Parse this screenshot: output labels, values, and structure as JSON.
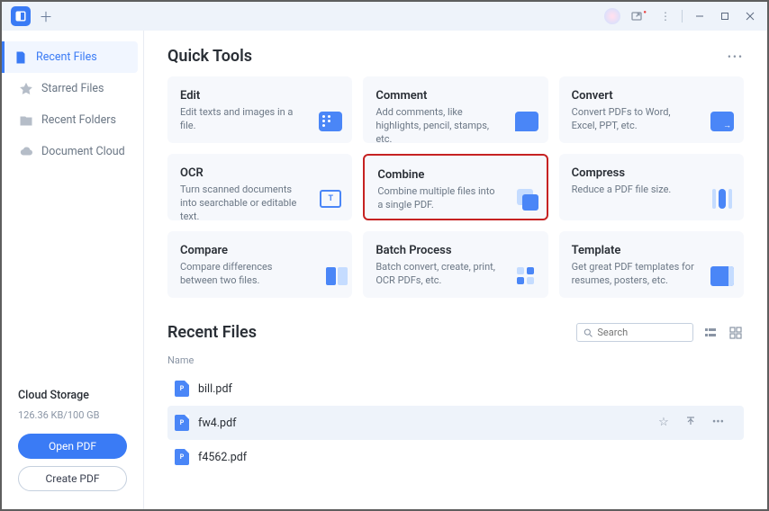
{
  "sidebar": {
    "items": [
      {
        "label": "Recent Files",
        "icon": "file"
      },
      {
        "label": "Starred Files",
        "icon": "star"
      },
      {
        "label": "Recent Folders",
        "icon": "folder"
      },
      {
        "label": "Document Cloud",
        "icon": "cloud"
      }
    ],
    "cloud": {
      "title": "Cloud Storage",
      "usage": "126.36 KB/100 GB",
      "open_label": "Open PDF",
      "create_label": "Create PDF"
    }
  },
  "quick_tools": {
    "title": "Quick Tools",
    "items": [
      {
        "title": "Edit",
        "desc": "Edit texts and images in a file.",
        "icon": "edit"
      },
      {
        "title": "Comment",
        "desc": "Add comments, like highlights, pencil, stamps, etc.",
        "icon": "comment"
      },
      {
        "title": "Convert",
        "desc": "Convert PDFs to Word, Excel, PPT, etc.",
        "icon": "convert"
      },
      {
        "title": "OCR",
        "desc": "Turn scanned documents into searchable or editable text.",
        "icon": "ocr"
      },
      {
        "title": "Combine",
        "desc": "Combine multiple files into a single PDF.",
        "icon": "combine",
        "highlight": true
      },
      {
        "title": "Compress",
        "desc": "Reduce a PDF file size.",
        "icon": "compress"
      },
      {
        "title": "Compare",
        "desc": "Compare differences between two files.",
        "icon": "compare"
      },
      {
        "title": "Batch Process",
        "desc": "Batch convert, create, print, OCR PDFs, etc.",
        "icon": "batch"
      },
      {
        "title": "Template",
        "desc": "Get great PDF templates for resumes, posters, etc.",
        "icon": "template"
      }
    ]
  },
  "recent": {
    "title": "Recent Files",
    "search_placeholder": "Search",
    "col_name": "Name",
    "files": [
      {
        "name": "bill.pdf"
      },
      {
        "name": "fw4.pdf",
        "selected": true
      },
      {
        "name": "f4562.pdf"
      }
    ]
  }
}
